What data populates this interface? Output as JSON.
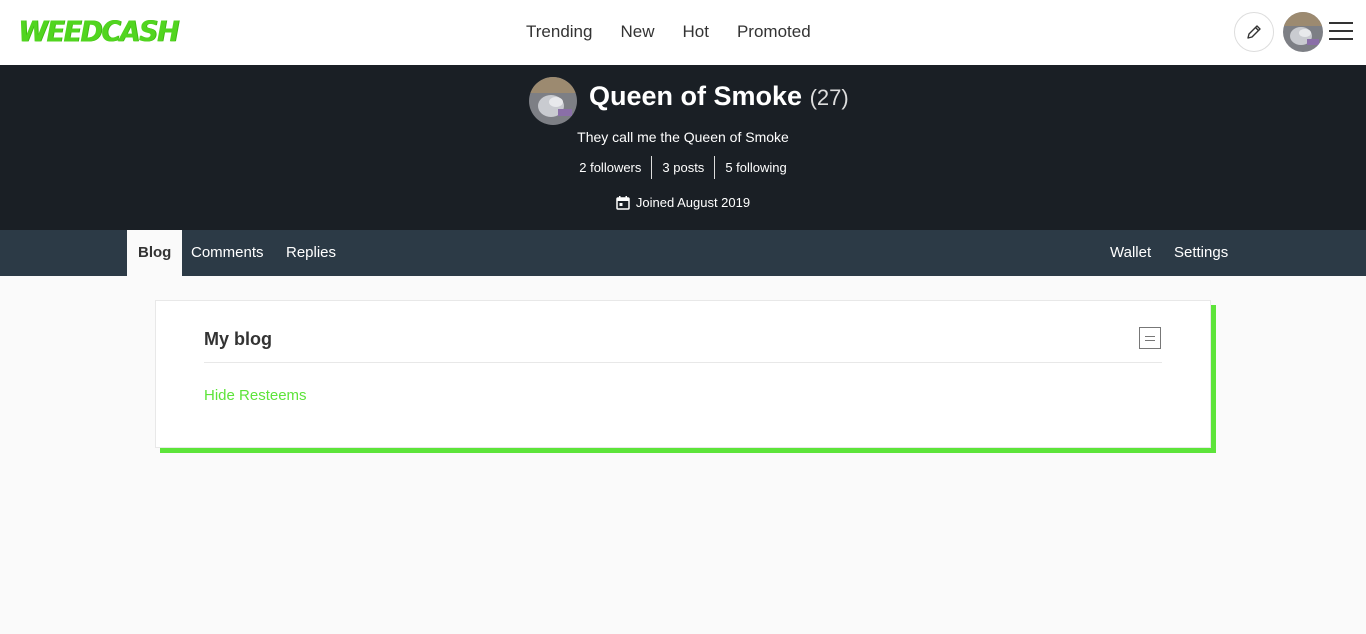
{
  "header": {
    "logo_text": "WEEDCASH",
    "nav": [
      "Trending",
      "New",
      "Hot",
      "Promoted"
    ],
    "icons": {
      "edit": "pencil-icon",
      "menu": "hamburger-menu-icon"
    }
  },
  "profile": {
    "name": "Queen of Smoke",
    "reputation": "(27)",
    "about": "They call me the Queen of Smoke",
    "stats": {
      "followers": "2 followers",
      "posts": "3 posts",
      "following": "5 following"
    },
    "joined": "Joined August 2019"
  },
  "tabs": {
    "blog": "Blog",
    "comments": "Comments",
    "replies": "Replies",
    "wallet": "Wallet",
    "settings": "Settings"
  },
  "blog": {
    "title": "My blog",
    "hide_resteems": "Hide Resteems"
  },
  "colors": {
    "brand": "#51d51f",
    "accent": "#5de43a",
    "hero_bg": "#1a1f25",
    "subnav_bg": "#2c3a46"
  }
}
